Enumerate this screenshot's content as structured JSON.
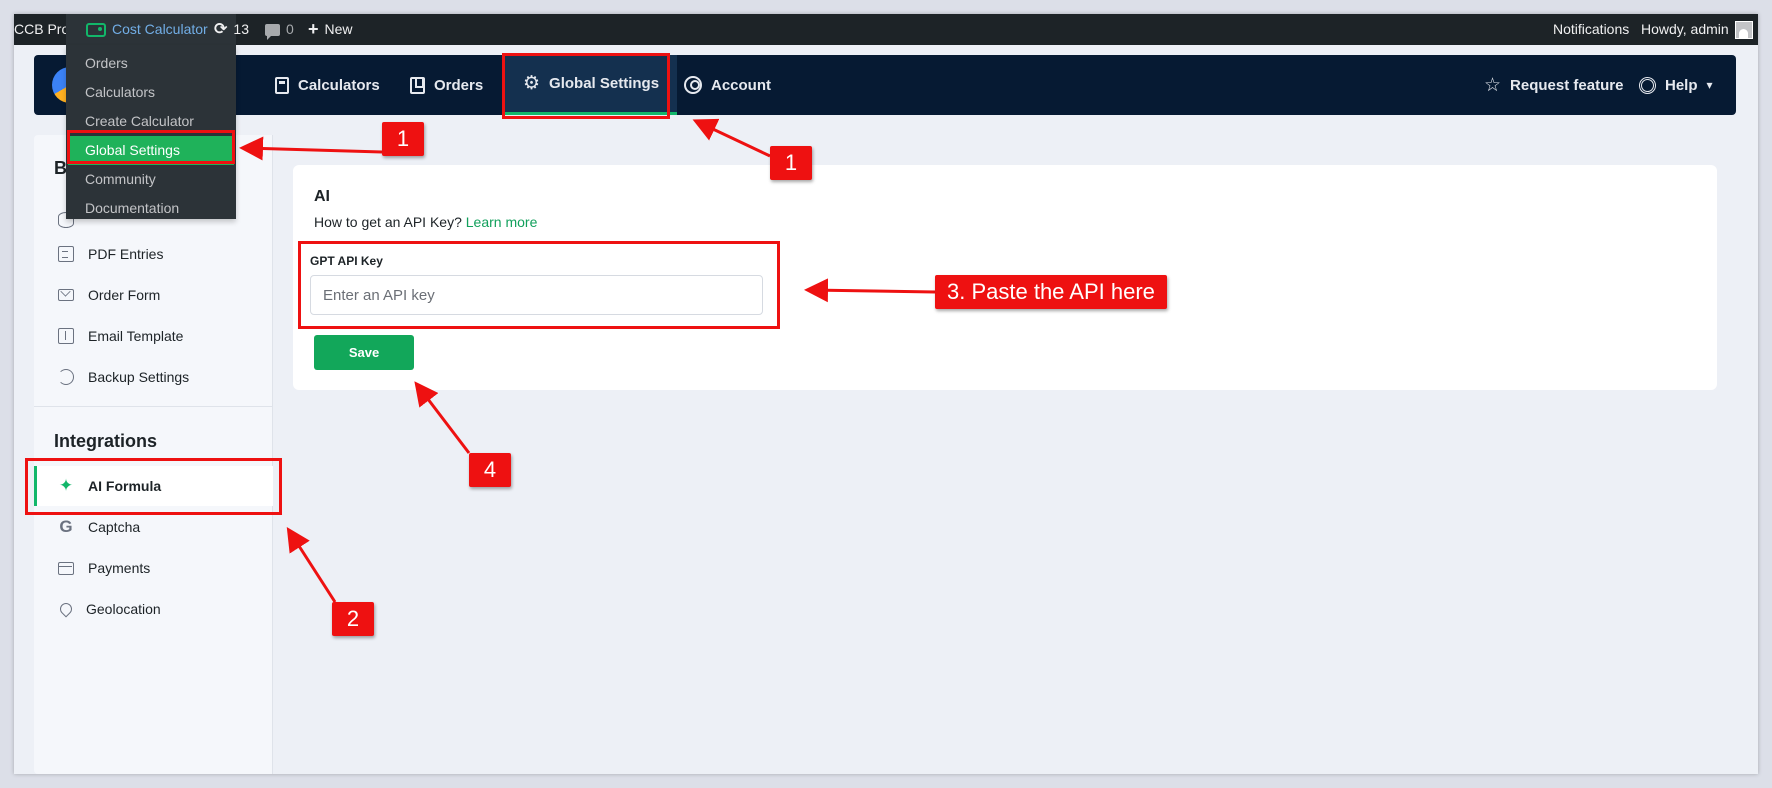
{
  "adminbar": {
    "site": "CCB Pro",
    "plugin": "Cost Calculator",
    "updates": "13",
    "comments": "0",
    "new": "New",
    "notifications": "Notifications",
    "howdy": "Howdy, admin"
  },
  "dropdown": {
    "items": [
      "Orders",
      "Calculators",
      "Create Calculator",
      "Global Settings",
      "Community",
      "Documentation"
    ]
  },
  "nav": {
    "calculators": "Calculators",
    "orders": "Orders",
    "global_settings": "Global Settings",
    "account": "Account",
    "request_feature": "Request feature",
    "help": "Help"
  },
  "sidebar": {
    "heading_partial": "B",
    "basic_items": [
      "PDF Entries",
      "Order Form",
      "Email Template",
      "Backup Settings"
    ],
    "integrations_heading": "Integrations",
    "integration_items": [
      "AI Formula",
      "Captcha",
      "Payments",
      "Geolocation"
    ]
  },
  "main": {
    "title": "AI",
    "subtitle": "How to get an API Key?",
    "learn_more": "Learn more",
    "field_label": "GPT API Key",
    "placeholder": "Enter an API key",
    "save": "Save"
  },
  "annotations": {
    "step1": "1",
    "step2": "2",
    "step3": "3. Paste the API here",
    "step4": "4",
    "color": "#ee1111"
  },
  "colors": {
    "accent": "#12b76a",
    "header_bg": "#061a33",
    "adminbar_bg": "#1d2327"
  }
}
